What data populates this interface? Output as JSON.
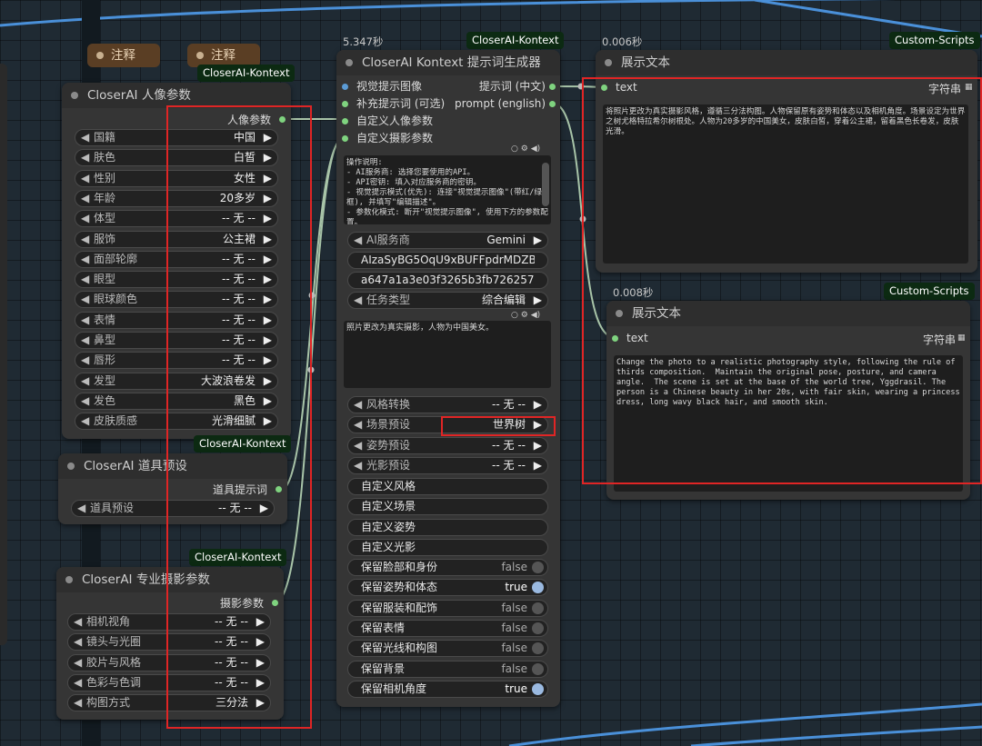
{
  "notes": [
    "注释",
    "注释"
  ],
  "portrait_node": {
    "badge": "CloserAI-Kontext",
    "title": "CloserAI 人像参数",
    "output": "人像参数",
    "widgets": [
      {
        "label": "国籍",
        "value": "中国"
      },
      {
        "label": "肤色",
        "value": "白皙"
      },
      {
        "label": "性别",
        "value": "女性"
      },
      {
        "label": "年龄",
        "value": "20多岁"
      },
      {
        "label": "体型",
        "value": "-- 无 --"
      },
      {
        "label": "服饰",
        "value": "公主裙"
      },
      {
        "label": "面部轮廓",
        "value": "-- 无 --"
      },
      {
        "label": "眼型",
        "value": "-- 无 --"
      },
      {
        "label": "眼球颜色",
        "value": "-- 无 --"
      },
      {
        "label": "表情",
        "value": "-- 无 --"
      },
      {
        "label": "鼻型",
        "value": "-- 无 --"
      },
      {
        "label": "唇形",
        "value": "-- 无 --"
      },
      {
        "label": "发型",
        "value": "大波浪卷发"
      },
      {
        "label": "发色",
        "value": "黑色"
      },
      {
        "label": "皮肤质感",
        "value": "光滑细腻"
      }
    ]
  },
  "props_node": {
    "badge": "CloserAI-Kontext",
    "title": "CloserAI 道具预设",
    "output": "道具提示词",
    "widgets": [
      {
        "label": "道具预设",
        "value": "-- 无 --"
      }
    ]
  },
  "photo_node": {
    "badge": "CloserAI-Kontext",
    "title": "CloserAI 专业摄影参数",
    "output": "摄影参数",
    "widgets": [
      {
        "label": "相机视角",
        "value": "-- 无 --"
      },
      {
        "label": "镜头与光圈",
        "value": "-- 无 --"
      },
      {
        "label": "胶片与风格",
        "value": "-- 无 --"
      },
      {
        "label": "色彩与色调",
        "value": "-- 无 --"
      },
      {
        "label": "构图方式",
        "value": "三分法"
      }
    ]
  },
  "generator_node": {
    "timing": "5.347秒",
    "badge": "CloserAI-Kontext",
    "title": "CloserAI Kontext 提示词生成器",
    "inputs": [
      "视觉提示图像",
      "补充提示词 (可选)",
      "自定义人像参数",
      "自定义摄影参数"
    ],
    "outputs": [
      "提示词 (中文)",
      "prompt (english)"
    ],
    "instructions": "操作说明:\n- AI服务商: 选择您要使用的API。\n- API密钥: 填入对应服务商的密钥。\n- 视觉提示模式(优先): 连接\"视觉提示图像\"(带红/绿框), 并填写\"编辑描述\"。\n- 参数化模式: 断开\"视觉提示图像\", 使用下方的参数配置。",
    "ai_provider": {
      "label": "AI服务商",
      "value": "Gemini"
    },
    "api_key": "AIzaSyBG5OqU9xBUFFpdrMDZBeL...",
    "api_secret": "a647a1a3e03f3265b3fb726257db2e ...",
    "task_type": {
      "label": "任务类型",
      "value": "综合编辑"
    },
    "edit_text": "照片更改为真实摄影，人物为中国美女。",
    "selects": [
      {
        "label": "风格转换",
        "value": "-- 无 --"
      },
      {
        "label": "场景预设",
        "value": "世界树"
      },
      {
        "label": "姿势预设",
        "value": "-- 无 --"
      },
      {
        "label": "光影预设",
        "value": "-- 无 --"
      }
    ],
    "custom_fields": [
      "自定义风格",
      "自定义场景",
      "自定义姿势",
      "自定义光影"
    ],
    "toggles": [
      {
        "label": "保留脸部和身份",
        "value": "false",
        "on": false
      },
      {
        "label": "保留姿势和体态",
        "value": "true",
        "on": true
      },
      {
        "label": "保留服装和配饰",
        "value": "false",
        "on": false
      },
      {
        "label": "保留表情",
        "value": "false",
        "on": false
      },
      {
        "label": "保留光线和构图",
        "value": "false",
        "on": false
      },
      {
        "label": "保留背景",
        "value": "false",
        "on": false
      },
      {
        "label": "保留相机角度",
        "value": "true",
        "on": true
      }
    ]
  },
  "display_cn": {
    "timing": "0.006秒",
    "badge": "Custom-Scripts",
    "title": "展示文本",
    "input": "text",
    "type": "字符串",
    "text": "将照片更改为真实摄影风格，遵循三分法构图。人物保留原有姿势和体态以及相机角度。场景设定为世界之树尤格特拉希尔树根处。人物为20多岁的中国美女，皮肤白皙，穿着公主裙，留着黑色长卷发，皮肤光滑。"
  },
  "display_en": {
    "timing": "0.008秒",
    "badge": "Custom-Scripts",
    "title": "展示文本",
    "input": "text",
    "type": "字符串",
    "text": "Change the photo to a realistic photography style, following the rule of thirds composition.  Maintain the original pose, posture, and camera angle.  The scene is set at the base of the world tree, Yggdrasil. The person is a Chinese beauty in her 20s, with fair skin, wearing a princess dress, long wavy black hair, and smooth skin."
  }
}
